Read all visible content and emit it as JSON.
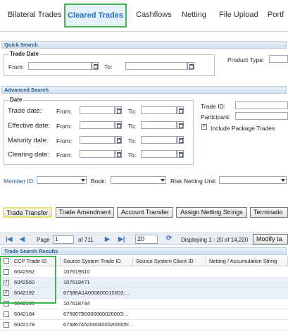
{
  "tabs": [
    {
      "label": "Bilateral Trades"
    },
    {
      "label": "Cleared Trades"
    },
    {
      "label": "Cashflows"
    },
    {
      "label": "Netting"
    },
    {
      "label": "File Upload"
    },
    {
      "label": "Portf"
    }
  ],
  "quick_search": {
    "header": "Quick Search",
    "trade_date_legend": "Trade Date",
    "from_label": "From:",
    "to_label": "To:",
    "product_type_label": "Product Type:"
  },
  "advanced_search": {
    "header": "Advanced Search",
    "date_legend": "Date",
    "rows": [
      {
        "label": "Trade date:",
        "from": "From:",
        "to": "To:"
      },
      {
        "label": "Effective date:",
        "from": "From:",
        "to": "To:"
      },
      {
        "label": "Maturity date:",
        "from": "From:",
        "to": "To:"
      },
      {
        "label": "Clearing date:",
        "from": "From:",
        "to": "To:"
      }
    ],
    "trade_id_label": "Trade ID:",
    "participant_label": "Participant:",
    "include_package_label": "Include Package Trades",
    "member_id_label": "Member ID:",
    "book_label": "Book:",
    "risk_netting_unit_label": "Risk Netting Unit:"
  },
  "actions": {
    "trade_transfer": "Trade Transfer",
    "trade_amendment": "Trade Amendment",
    "account_transfer": "Account Transfer",
    "assign_netting_strings": "Assign Netting Strings",
    "termination": "Terminatio"
  },
  "pager": {
    "page_label": "Page",
    "page_value": "1",
    "of_label": "of 711",
    "page_size": "20",
    "displaying": "Displaying 1 - 20 of 14,220",
    "modify_button": "Modify ta"
  },
  "results": {
    "header": "Trade Search Results",
    "columns": [
      "CCP Trade ID",
      "Source System Trade ID",
      "Source System Client ID",
      "Netting / Accumulation String"
    ],
    "rows": [
      {
        "ccp": "6042562",
        "src": "107619510",
        "checked": false
      },
      {
        "ccp": "6042560",
        "src": "107619471",
        "checked": true
      },
      {
        "ccp": "6042192",
        "src": "67586A1A000800010003:...",
        "checked": true
      },
      {
        "ccp": "6042189",
        "src": "107618744",
        "checked": false
      },
      {
        "ccp": "6042184",
        "src": "675867B000080002000З:...",
        "checked": false
      },
      {
        "ccp": "6042178",
        "src": "6758674520004000200005:...",
        "checked": false
      }
    ]
  },
  "colors": {
    "highlight": "#3fb34f",
    "active_tab_text": "#1e72c4",
    "section_header_text": "#2a5b8c"
  }
}
